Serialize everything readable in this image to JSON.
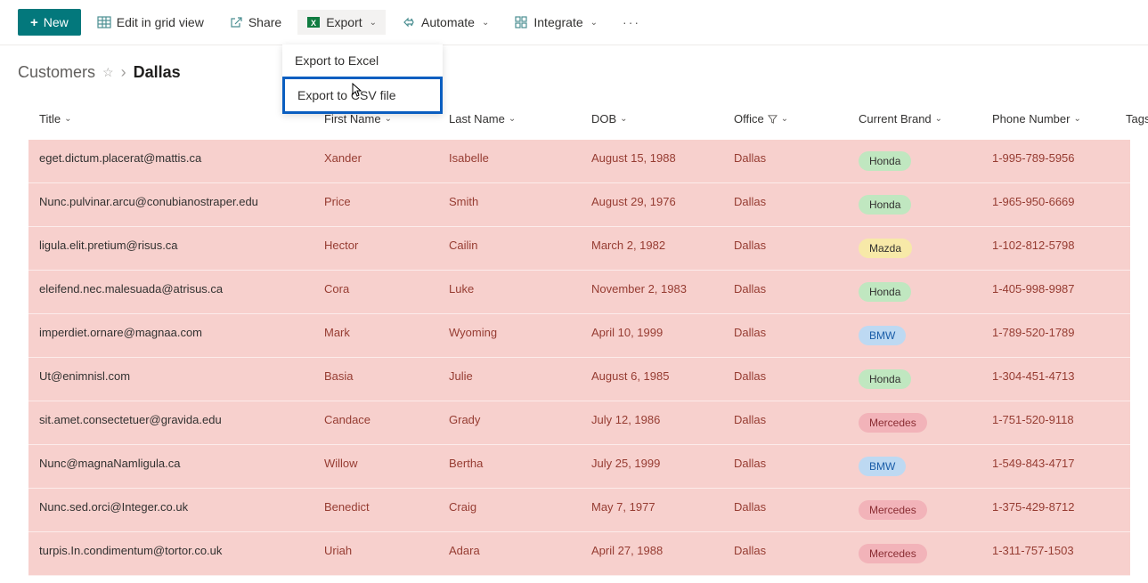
{
  "toolbar": {
    "new_label": "New",
    "edit_grid_label": "Edit in grid view",
    "share_label": "Share",
    "export_label": "Export",
    "automate_label": "Automate",
    "integrate_label": "Integrate"
  },
  "export_menu": {
    "excel": "Export to Excel",
    "csv": "Export to CSV file"
  },
  "breadcrumb": {
    "root": "Customers",
    "current": "Dallas"
  },
  "columns": {
    "title": "Title",
    "first_name": "First Name",
    "last_name": "Last Name",
    "dob": "DOB",
    "office": "Office",
    "brand": "Current Brand",
    "phone": "Phone Number",
    "tags": "Tags"
  },
  "rows": [
    {
      "title": "eget.dictum.placerat@mattis.ca",
      "first": "Xander",
      "last": "Isabelle",
      "dob": "August 15, 1988",
      "office": "Dallas",
      "brand": "Honda",
      "phone": "1-995-789-5956"
    },
    {
      "title": "Nunc.pulvinar.arcu@conubianostraper.edu",
      "first": "Price",
      "last": "Smith",
      "dob": "August 29, 1976",
      "office": "Dallas",
      "brand": "Honda",
      "phone": "1-965-950-6669"
    },
    {
      "title": "ligula.elit.pretium@risus.ca",
      "first": "Hector",
      "last": "Cailin",
      "dob": "March 2, 1982",
      "office": "Dallas",
      "brand": "Mazda",
      "phone": "1-102-812-5798"
    },
    {
      "title": "eleifend.nec.malesuada@atrisus.ca",
      "first": "Cora",
      "last": "Luke",
      "dob": "November 2, 1983",
      "office": "Dallas",
      "brand": "Honda",
      "phone": "1-405-998-9987"
    },
    {
      "title": "imperdiet.ornare@magnaa.com",
      "first": "Mark",
      "last": "Wyoming",
      "dob": "April 10, 1999",
      "office": "Dallas",
      "brand": "BMW",
      "phone": "1-789-520-1789"
    },
    {
      "title": "Ut@enimnisl.com",
      "first": "Basia",
      "last": "Julie",
      "dob": "August 6, 1985",
      "office": "Dallas",
      "brand": "Honda",
      "phone": "1-304-451-4713"
    },
    {
      "title": "sit.amet.consectetuer@gravida.edu",
      "first": "Candace",
      "last": "Grady",
      "dob": "July 12, 1986",
      "office": "Dallas",
      "brand": "Mercedes",
      "phone": "1-751-520-9118"
    },
    {
      "title": "Nunc@magnaNamligula.ca",
      "first": "Willow",
      "last": "Bertha",
      "dob": "July 25, 1999",
      "office": "Dallas",
      "brand": "BMW",
      "phone": "1-549-843-4717"
    },
    {
      "title": "Nunc.sed.orci@Integer.co.uk",
      "first": "Benedict",
      "last": "Craig",
      "dob": "May 7, 1977",
      "office": "Dallas",
      "brand": "Mercedes",
      "phone": "1-375-429-8712"
    },
    {
      "title": "turpis.In.condimentum@tortor.co.uk",
      "first": "Uriah",
      "last": "Adara",
      "dob": "April 27, 1988",
      "office": "Dallas",
      "brand": "Mercedes",
      "phone": "1-311-757-1503"
    }
  ]
}
